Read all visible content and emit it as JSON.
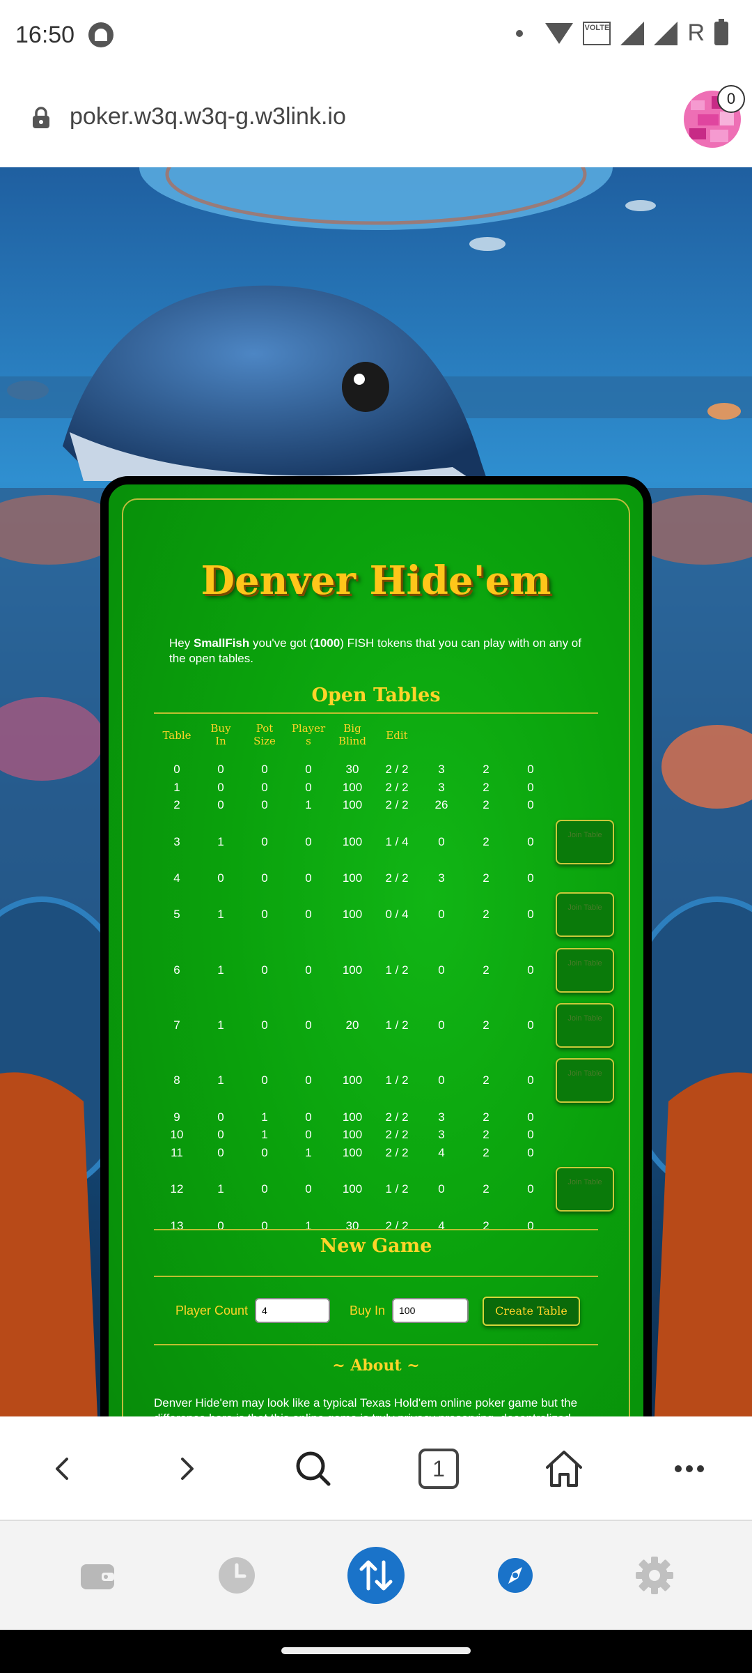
{
  "status_bar": {
    "time": "16:50",
    "volte": "VOLTE",
    "roaming": "R"
  },
  "browser": {
    "url": "poker.w3q.w3q-g.w3link.io",
    "notification_count": "0",
    "tab_count": "1"
  },
  "game": {
    "title": "Denver Hide'em",
    "intro": {
      "pre": "Hey ",
      "username": "SmallFish",
      "mid": " you've got (",
      "tokens": "1000",
      "post": ") FISH tokens that you can play with on any of the open tables."
    },
    "open_tables_title": "Open Tables",
    "headers": {
      "table": "Table",
      "buy_in": [
        "Buy",
        "In"
      ],
      "pot_size": [
        "Pot",
        "Size"
      ],
      "players": [
        "Player",
        "s"
      ],
      "big_blind": [
        "Big",
        "Blind"
      ],
      "edit": "Edit"
    },
    "join_label": "Join Table",
    "rows": [
      [
        "0",
        "0",
        "0",
        "0",
        "30",
        "2 / 2",
        "3",
        "2",
        "0",
        false
      ],
      [
        "1",
        "0",
        "0",
        "0",
        "100",
        "2 / 2",
        "3",
        "2",
        "0",
        false
      ],
      [
        "2",
        "0",
        "0",
        "1",
        "100",
        "2 / 2",
        "26",
        "2",
        "0",
        false
      ],
      [
        "3",
        "1",
        "0",
        "0",
        "100",
        "1 / 4",
        "0",
        "2",
        "0",
        true
      ],
      [
        "4",
        "0",
        "0",
        "0",
        "100",
        "2 / 2",
        "3",
        "2",
        "0",
        false
      ],
      [
        "5",
        "1",
        "0",
        "0",
        "100",
        "0 / 4",
        "0",
        "2",
        "0",
        true
      ],
      [
        "6",
        "1",
        "0",
        "0",
        "100",
        "1 / 2",
        "0",
        "2",
        "0",
        true
      ],
      [
        "7",
        "1",
        "0",
        "0",
        "20",
        "1 / 2",
        "0",
        "2",
        "0",
        true
      ],
      [
        "8",
        "1",
        "0",
        "0",
        "100",
        "1 / 2",
        "0",
        "2",
        "0",
        true
      ],
      [
        "9",
        "0",
        "1",
        "0",
        "100",
        "2 / 2",
        "3",
        "2",
        "0",
        false
      ],
      [
        "10",
        "0",
        "1",
        "0",
        "100",
        "2 / 2",
        "3",
        "2",
        "0",
        false
      ],
      [
        "11",
        "0",
        "0",
        "1",
        "100",
        "2 / 2",
        "4",
        "2",
        "0",
        false
      ],
      [
        "12",
        "1",
        "0",
        "0",
        "100",
        "1 / 2",
        "0",
        "2",
        "0",
        true
      ],
      [
        "13",
        "0",
        "0",
        "1",
        "30",
        "2 / 2",
        "4",
        "2",
        "0",
        false
      ]
    ],
    "new_game": {
      "title": "New Game",
      "player_count_label": "Player Count",
      "player_count_value": "4",
      "buy_in_label": "Buy In",
      "buy_in_value": "100",
      "create_button": "Create Table"
    },
    "about": {
      "title": "~ About ~",
      "text": "Denver Hide'em may look like a typical Texas Hold'em online poker game but the difference here is that this online game is truly privacy preserving, decentralized"
    }
  },
  "nav_icons": [
    "back-icon",
    "forward-icon",
    "search-icon",
    "tabs-icon",
    "home-icon",
    "more-icon"
  ],
  "dock_icons": [
    "wallet-icon",
    "history-icon",
    "transfer-icon",
    "discover-icon",
    "settings-icon"
  ],
  "colors": {
    "gold": "#ffd42a",
    "felt_green": "#0aa10c",
    "dock_blue": "#1a73c9"
  }
}
